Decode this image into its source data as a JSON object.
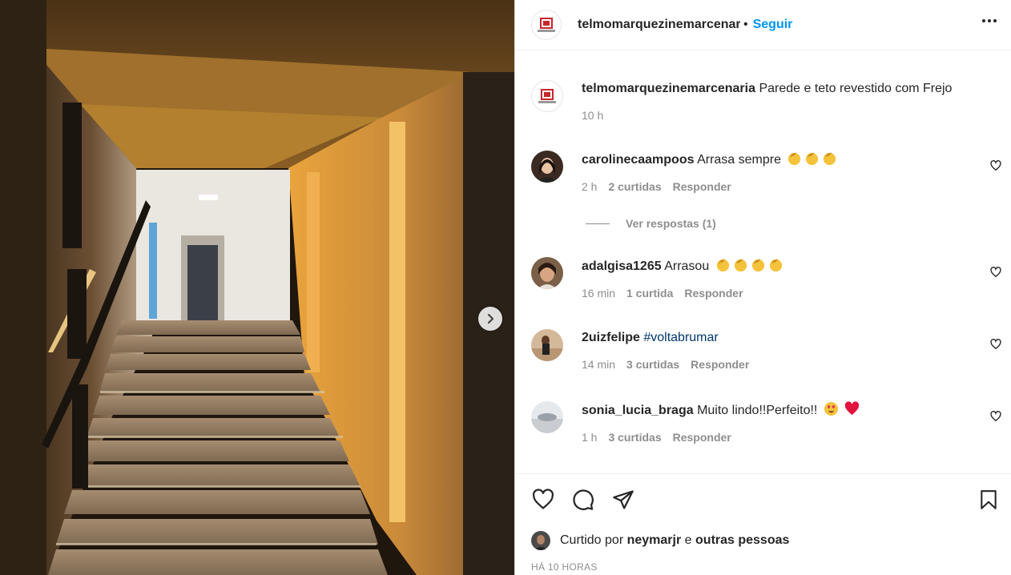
{
  "post": {
    "author": "telmomarquezinemarcenaria",
    "header_username": "telmomarquezinemarcenaria",
    "dot": "•",
    "follow_label": "Seguir",
    "caption": "Parede e teto revestido com Frejo",
    "caption_time": "10 h"
  },
  "comments": [
    {
      "user": "carolinecaampoos",
      "text": "Arrasa sempre",
      "time": "2 h",
      "likes": "2 curtidas",
      "reply": "Responder",
      "emoji_count": 3
    },
    {
      "user": "adalgisa1265",
      "text": "Arrasou",
      "time": "16 min",
      "likes": "1 curtida",
      "reply": "Responder",
      "emoji_count": 4
    },
    {
      "user": "2uizfelipe",
      "text": "",
      "tag": "#voltabrumar",
      "time": "14 min",
      "likes": "3 curtidas",
      "reply": "Responder"
    },
    {
      "user": "sonia_lucia_braga",
      "text": "Muito lindo!!Perfeito!!",
      "time": "1 h",
      "likes": "3 curtidas",
      "reply": "Responder"
    }
  ],
  "view_replies": "Ver respostas (1)",
  "liked_by": {
    "prefix": "Curtido por",
    "user": "neymarjr",
    "connector": "e",
    "others": "outras pessoas"
  },
  "timestamp": "HÁ 10 HORAS",
  "icons": [
    "ellipsis-icon",
    "heart-icon",
    "comment-icon",
    "share-icon",
    "bookmark-icon",
    "chevron-right-icon"
  ],
  "colors": {
    "link": "#0095f6",
    "text": "#262626",
    "muted": "#8e8e8e",
    "brand": "#c8262b"
  }
}
